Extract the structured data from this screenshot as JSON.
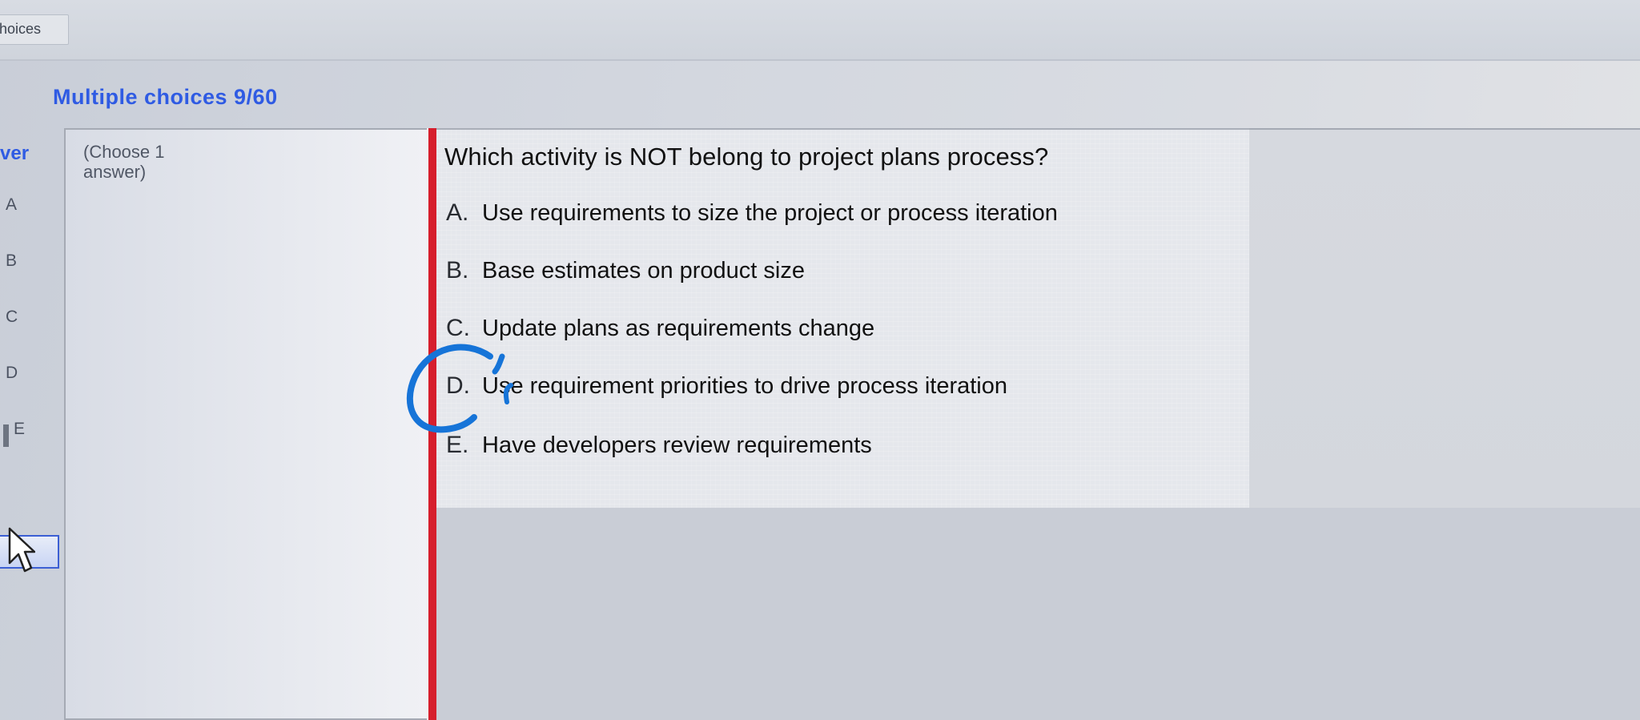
{
  "tab": {
    "label": "hoices"
  },
  "header": {
    "title": "Multiple choices 9/60"
  },
  "left_rail": {
    "header": "ver",
    "letters": [
      "A",
      "B",
      "C",
      "D",
      "E"
    ]
  },
  "instructions": {
    "text": "(Choose 1 answer)"
  },
  "question": {
    "text": "Which activity is NOT belong to project plans process?",
    "options": [
      {
        "letter": "A.",
        "text": "Use requirements to size the project or process iteration"
      },
      {
        "letter": "B.",
        "text": "Base estimates on product size"
      },
      {
        "letter": "C.",
        "text": "Update plans as requirements change"
      },
      {
        "letter": "D.",
        "text": "Use requirement priorities to drive process iteration"
      },
      {
        "letter": "E.",
        "text": "Have developers review requirements"
      }
    ]
  },
  "icons": {
    "cursor": "mouse-pointer-icon",
    "pen_mark": "handwritten-circle-mark"
  },
  "colors": {
    "title_blue": "#2f5be3",
    "divider_red": "#d61f2d",
    "pen_blue": "#1674d8"
  }
}
